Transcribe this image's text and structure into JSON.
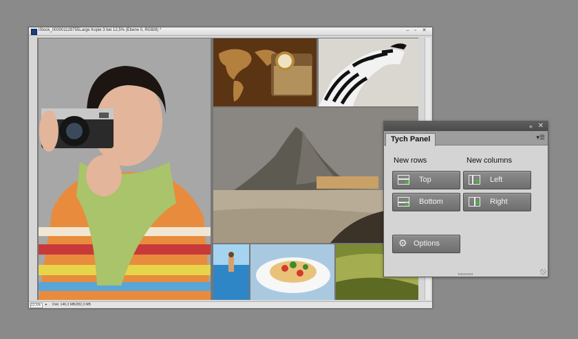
{
  "document": {
    "title": "iStock_000001129755Large Kopie 3 bei 12,5% (Ebene 0, RGB/8) *",
    "window_buttons": [
      "‒",
      "▫",
      "✕"
    ],
    "zoom": "12,5%",
    "status_text": "Dok: 146,3 MB/282,3 MB"
  },
  "photos": [
    "woman-with-camera",
    "world-map-and-compass",
    "zebra",
    "coastal-rock",
    "swimming-pool",
    "pasta-plate",
    "grass-field"
  ],
  "panel": {
    "tab_label": "Tych Panel",
    "new_rows_label": "New rows",
    "new_columns_label": "New columns",
    "buttons": {
      "top": "Top",
      "bottom": "Bottom",
      "left": "Left",
      "right": "Right",
      "options": "Options"
    },
    "icons": {
      "collapse": "double-chevron-left-icon",
      "close": "close-icon",
      "menu": "panel-menu-icon",
      "options": "gear-icon"
    }
  },
  "colors": {
    "background": "#8a8a8a",
    "panel": "#d4d4d4",
    "button": "#7c7c7c",
    "add_icon_green": "#3cbf2e"
  }
}
